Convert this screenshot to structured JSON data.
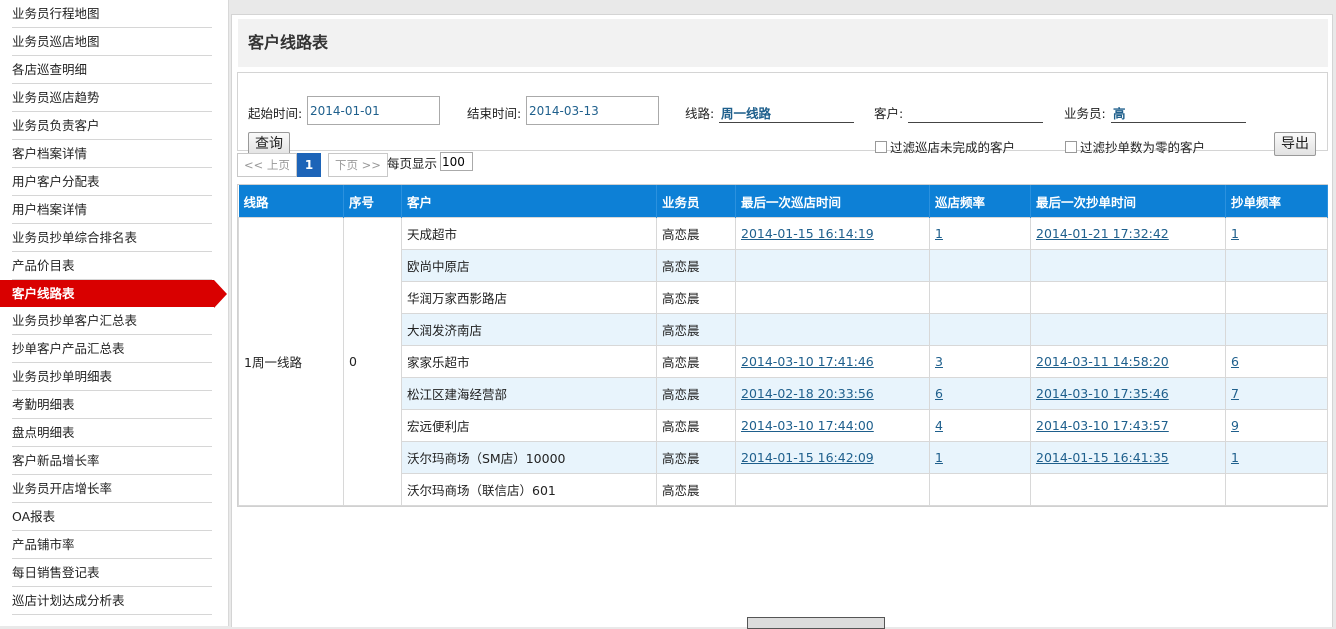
{
  "sidebar": {
    "items": [
      {
        "label": "业务员行程地图"
      },
      {
        "label": "业务员巡店地图"
      },
      {
        "label": "各店巡查明细"
      },
      {
        "label": "业务员巡店趋势"
      },
      {
        "label": "业务员负责客户"
      },
      {
        "label": "客户档案详情"
      },
      {
        "label": "用户客户分配表"
      },
      {
        "label": "用户档案详情"
      },
      {
        "label": "业务员抄单综合排名表"
      },
      {
        "label": "产品价目表"
      },
      {
        "label": "客户线路表"
      },
      {
        "label": "业务员抄单客户汇总表"
      },
      {
        "label": "抄单客户产品汇总表"
      },
      {
        "label": "业务员抄单明细表"
      },
      {
        "label": "考勤明细表"
      },
      {
        "label": "盘点明细表"
      },
      {
        "label": "客户新品增长率"
      },
      {
        "label": "业务员开店增长率"
      },
      {
        "label": "OA报表"
      },
      {
        "label": "产品铺市率"
      },
      {
        "label": "每日销售登记表"
      },
      {
        "label": "巡店计划达成分析表"
      }
    ],
    "active_index": 10,
    "active_color": "#d90000"
  },
  "page": {
    "title": "客户线路表"
  },
  "filters": {
    "start_label": "起始时间:",
    "start_value": "2014-01-01",
    "end_label": "结束时间:",
    "end_value": "2014-03-13",
    "route_label": "线路:",
    "route_value": "周一线路",
    "customer_label": "客户:",
    "customer_value": "",
    "salesman_label": "业务员:",
    "salesman_value": "高",
    "query_button": "查询",
    "export_button": "导出",
    "check_unfinished": "过滤巡店未完成的客户",
    "check_zero": "过滤抄单数为零的客户"
  },
  "pager": {
    "prev": "<< 上页",
    "current": "1",
    "next": "下页 >>",
    "per_page_label": "每页显示",
    "per_page_value": "100"
  },
  "table": {
    "header_color": "#0d80d6",
    "columns": [
      "线路",
      "序号",
      "客户",
      "业务员",
      "最后一次巡店时间",
      "巡店频率",
      "最后一次抄单时间",
      "抄单频率"
    ],
    "route": "1周一线路",
    "index": "0",
    "rows": [
      {
        "customer": "天成超市",
        "salesman": "高恋晨",
        "last_visit": "2014-01-15 16:14:19",
        "visit_freq": "1",
        "last_order": "2014-01-21 17:32:42",
        "order_freq": "1"
      },
      {
        "customer": "欧尚中原店",
        "salesman": "高恋晨",
        "last_visit": "",
        "visit_freq": "",
        "last_order": "",
        "order_freq": ""
      },
      {
        "customer": "华润万家西影路店",
        "salesman": "高恋晨",
        "last_visit": "",
        "visit_freq": "",
        "last_order": "",
        "order_freq": ""
      },
      {
        "customer": "大润发济南店",
        "salesman": "高恋晨",
        "last_visit": "",
        "visit_freq": "",
        "last_order": "",
        "order_freq": ""
      },
      {
        "customer": "家家乐超市",
        "salesman": "高恋晨",
        "last_visit": "2014-03-10 17:41:46",
        "visit_freq": "3",
        "last_order": "2014-03-11 14:58:20",
        "order_freq": "6"
      },
      {
        "customer": "松江区建海经营部",
        "salesman": "高恋晨",
        "last_visit": "2014-02-18 20:33:56",
        "visit_freq": "6",
        "last_order": "2014-03-10 17:35:46",
        "order_freq": "7"
      },
      {
        "customer": "宏远便利店",
        "salesman": "高恋晨",
        "last_visit": "2014-03-10 17:44:00",
        "visit_freq": "4",
        "last_order": "2014-03-10 17:43:57",
        "order_freq": "9"
      },
      {
        "customer": "沃尔玛商场（SM店）10000",
        "salesman": "高恋晨",
        "last_visit": "2014-01-15 16:42:09",
        "visit_freq": "1",
        "last_order": "2014-01-15 16:41:35",
        "order_freq": "1"
      },
      {
        "customer": "沃尔玛商场（联信店）601",
        "salesman": "高恋晨",
        "last_visit": "",
        "visit_freq": "",
        "last_order": "",
        "order_freq": ""
      }
    ]
  }
}
